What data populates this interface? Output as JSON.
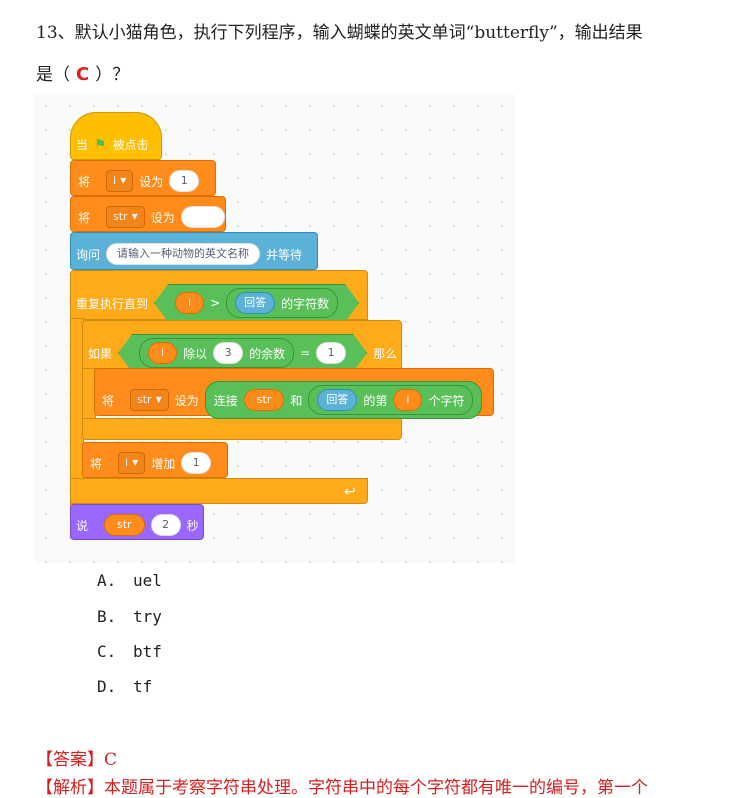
{
  "question": {
    "line1": "13、默认小猫角色，执行下列程序，输入蝴蝶的英文单词“butterfly”，输出结果",
    "line2_prefix": "是（",
    "answer_fill": "C",
    "line2_suffix": "）？"
  },
  "scratch": {
    "event": {
      "when": "当",
      "flag_icon": "green-flag",
      "clicked": "被点击"
    },
    "set_i": {
      "label": "将",
      "var": "i",
      "to": "设为",
      "value": "1"
    },
    "set_str": {
      "label": "将",
      "var": "str",
      "to": "设为",
      "value": ""
    },
    "ask": {
      "label": "询问",
      "prompt": "请输入一种动物的英文名称",
      "wait": "并等待"
    },
    "repeat": {
      "label": "重复执行直到",
      "var": "i",
      "op": ">",
      "answer": "回答",
      "length": "的字符数"
    },
    "if": {
      "label": "如果",
      "var": "i",
      "mod": "除以",
      "divisor": "3",
      "remainder": "的余数",
      "eq": "=",
      "value": "1",
      "then": "那么"
    },
    "set_join": {
      "label": "将",
      "var": "str",
      "to": "设为",
      "join": "连接",
      "arg": "str",
      "and": "和",
      "answer": "回答",
      "nth": "的第",
      "index": "i",
      "char": "个字符"
    },
    "change_i": {
      "label": "将",
      "var": "i",
      "by": "增加",
      "value": "1"
    },
    "loop_arrow": "↩",
    "say": {
      "label": "说",
      "var": "str",
      "secs": "2",
      "unit": "秒"
    }
  },
  "options": [
    {
      "letter": "A.",
      "text": "uel"
    },
    {
      "letter": "B.",
      "text": "try"
    },
    {
      "letter": "C.",
      "text": "btf"
    },
    {
      "letter": "D.",
      "text": "tf"
    }
  ],
  "answer": {
    "label": "【答案】",
    "value": "C"
  },
  "analysis": {
    "label": "【解析】",
    "text": "本题属于考察字符串处理。字符串中的每个字符都有唯一的编号，第一个"
  },
  "colors": {
    "event": "#ffbf00",
    "variable": "#ff8c1a",
    "sensing": "#5cb1d6",
    "control": "#ffab19",
    "looks": "#9966ff",
    "operator": "#59c059",
    "answer_red": "#d42020"
  }
}
